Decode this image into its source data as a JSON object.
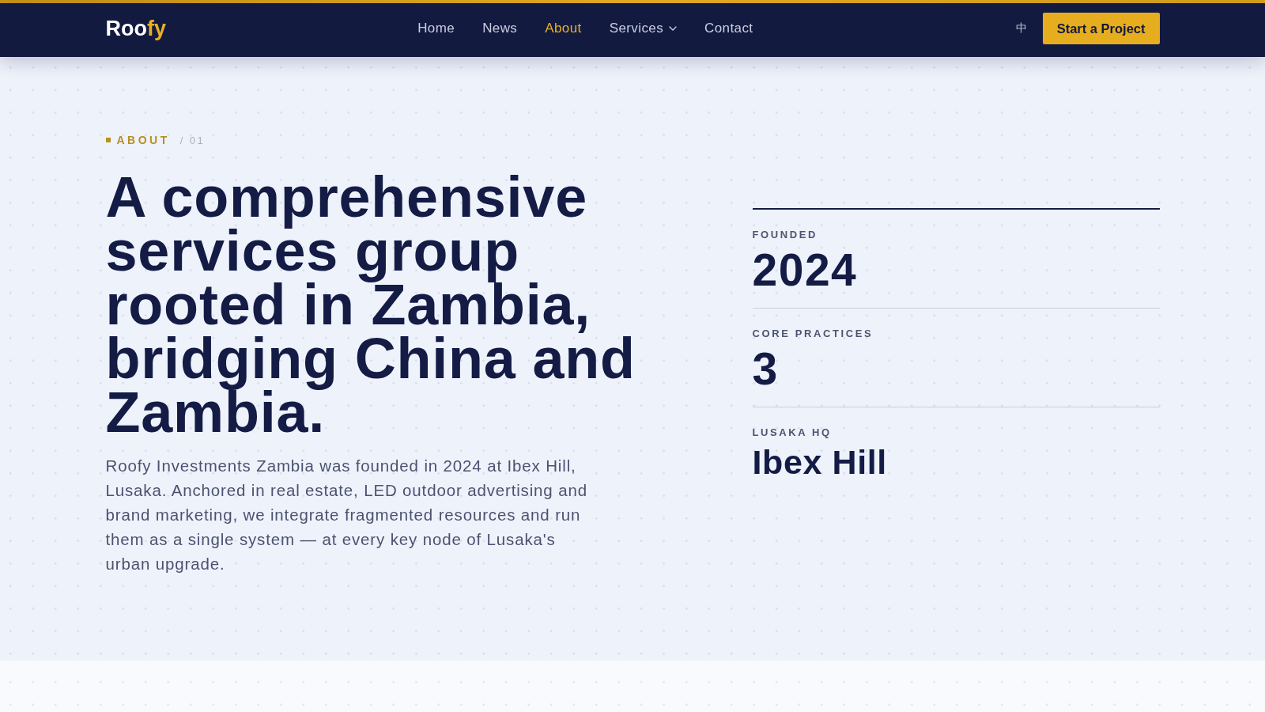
{
  "header": {
    "logo": {
      "text": "Roo",
      "accent": "fy"
    },
    "nav": [
      {
        "label": "Home",
        "selected": false,
        "dropdown": false
      },
      {
        "label": "News",
        "selected": false,
        "dropdown": false
      },
      {
        "label": "About",
        "selected": true,
        "dropdown": false
      },
      {
        "label": "Services",
        "selected": false,
        "dropdown": true
      },
      {
        "label": "Contact",
        "selected": false,
        "dropdown": false
      }
    ],
    "language": "中",
    "cta": "Start a Project"
  },
  "hero": {
    "eyebrow": {
      "label": "ABOUT",
      "index": "/ 01"
    },
    "headline": "A comprehensive services group rooted in Zambia, bridging China and Zambia.",
    "body": "Roofy Investments Zambia was founded in 2024 at Ibex Hill, Lusaka. Anchored in real estate, LED outdoor advertising and brand marketing, we integrate fragmented resources and run them as a single system — at every key node of Lusaka's urban upgrade.",
    "stats": [
      {
        "label": "FOUNDED",
        "value": "2024",
        "kind": "number"
      },
      {
        "label": "CORE PRACTICES",
        "value": "3",
        "kind": "number"
      },
      {
        "label": "LUSAKA HQ",
        "value": "Ibex Hill",
        "kind": "text"
      }
    ]
  }
}
